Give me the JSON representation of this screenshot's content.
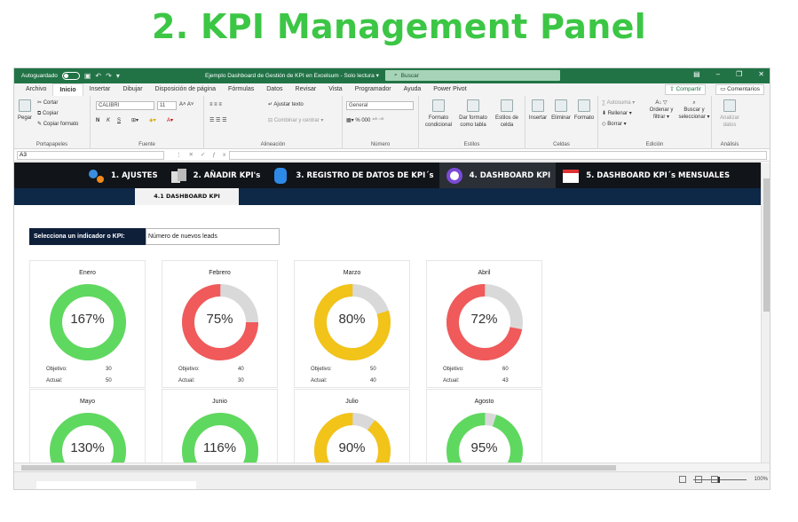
{
  "heading": "2. KPI Management Panel",
  "titlebar": {
    "autosave": "Autoguardado",
    "doc_title": "Ejemplo Dashboard de Gestión de KPI en Excelsum  -  Solo lectura  ▾",
    "search": "Buscar"
  },
  "menu": {
    "items": [
      "Archivo",
      "Inicio",
      "Insertar",
      "Dibujar",
      "Disposición de página",
      "Fórmulas",
      "Datos",
      "Revisar",
      "Vista",
      "Programador",
      "Ayuda",
      "Power Pivot"
    ],
    "active_index": 1,
    "share": "Compartir",
    "comments": "Comentarios"
  },
  "ribbon": {
    "clipboard": {
      "paste": "Pegar",
      "cut": "Cortar",
      "copy": "Copiar",
      "format_painter": "Copiar formato",
      "label": "Portapapeles"
    },
    "font": {
      "name": "CALIBRI",
      "size": "11",
      "label": "Fuente"
    },
    "alignment": {
      "wrap": "Ajustar texto",
      "merge": "Combinar y centrar",
      "label": "Alineación"
    },
    "number": {
      "format": "General",
      "label": "Número"
    },
    "styles": {
      "conditional": "Formato condicional",
      "table": "Dar formato como tabla",
      "cell_styles": "Estilos de celda",
      "label": "Estilos"
    },
    "cells": {
      "insert": "Insertar",
      "delete": "Eliminar",
      "format": "Formato",
      "label": "Celdas"
    },
    "editing": {
      "autosum": "Autosuma",
      "fill": "Rellenar",
      "clear": "Borrar",
      "sort": "Ordenar y filtrar",
      "find": "Buscar y seleccionar",
      "label": "Edición"
    },
    "analysis": {
      "analyze": "Analizar datos",
      "label": "Análisis"
    }
  },
  "formula_bar": {
    "cell": "A3"
  },
  "nav": {
    "items": [
      {
        "label": "1. AJUSTES"
      },
      {
        "label": "2. AÑADIR KPI's"
      },
      {
        "label": "3. REGISTRO DE DATOS DE KPI´s"
      },
      {
        "label": "4. DASHBOARD KPI"
      },
      {
        "label": "5. DASHBOARD KPI´s MENSUALES"
      }
    ],
    "active_index": 3,
    "subtab": "4.1 DASHBOARD KPI"
  },
  "selector": {
    "label": "Selecciona un indicador o KPI:",
    "value": "Número de nuevos leads"
  },
  "cards": {
    "objective_label": "Objetivo:",
    "actual_label": "Actual:",
    "months": [
      {
        "month": "Enero",
        "pct": "167%",
        "fill": 1.0,
        "color": "#5fd85f",
        "objective": "30",
        "actual": "50"
      },
      {
        "month": "Febrero",
        "pct": "75%",
        "fill": 0.75,
        "color": "#f05a5a",
        "objective": "40",
        "actual": "30"
      },
      {
        "month": "Marzo",
        "pct": "80%",
        "fill": 0.8,
        "color": "#f2c318",
        "objective": "50",
        "actual": "40"
      },
      {
        "month": "Abril",
        "pct": "72%",
        "fill": 0.72,
        "color": "#f05a5a",
        "objective": "60",
        "actual": "43"
      },
      {
        "month": "Mayo",
        "pct": "130%",
        "fill": 1.0,
        "color": "#5fd85f"
      },
      {
        "month": "Junio",
        "pct": "116%",
        "fill": 1.0,
        "color": "#5fd85f"
      },
      {
        "month": "Julio",
        "pct": "90%",
        "fill": 0.9,
        "color": "#f2c318"
      },
      {
        "month": "Agosto",
        "pct": "95%",
        "fill": 0.95,
        "color": "#5fd85f"
      }
    ]
  },
  "status": {
    "zoom": "100%"
  }
}
